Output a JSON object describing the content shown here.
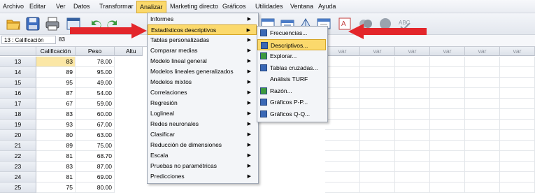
{
  "menubar": {
    "items": [
      "Archivo",
      "Editar",
      "Ver",
      "Datos",
      "Transformar",
      "Analizar",
      "Marketing directo",
      "Gráficos",
      "Utilidades",
      "Ventana",
      "Ayuda"
    ]
  },
  "refbar": {
    "cell_ref": "13 : Calificación",
    "cell_value": "83"
  },
  "grid": {
    "columns": [
      "Calificación",
      "Peso",
      "Altu",
      "var",
      "var",
      "var",
      "var",
      "var",
      "var",
      "var"
    ],
    "rows": [
      {
        "n": "13",
        "c": "83",
        "p": "78.00"
      },
      {
        "n": "14",
        "c": "89",
        "p": "95.00"
      },
      {
        "n": "15",
        "c": "95",
        "p": "49.00"
      },
      {
        "n": "16",
        "c": "87",
        "p": "54.00"
      },
      {
        "n": "17",
        "c": "67",
        "p": "59.00"
      },
      {
        "n": "18",
        "c": "83",
        "p": "60.00"
      },
      {
        "n": "19",
        "c": "93",
        "p": "67.00"
      },
      {
        "n": "20",
        "c": "80",
        "p": "63.00"
      },
      {
        "n": "21",
        "c": "89",
        "p": "75.00"
      },
      {
        "n": "22",
        "c": "81",
        "p": "68.70"
      },
      {
        "n": "23",
        "c": "83",
        "p": "87.00"
      },
      {
        "n": "24",
        "c": "81",
        "p": "69.00"
      },
      {
        "n": "25",
        "c": "75",
        "p": "80.00"
      }
    ]
  },
  "analizar_menu": {
    "items": [
      {
        "label": "Informes",
        "sub": true
      },
      {
        "label": "Estadísticos descriptivos",
        "sub": true
      },
      {
        "label": "Tablas personalizadas",
        "sub": true
      },
      {
        "label": "Comparar medias",
        "sub": true
      },
      {
        "label": "Modelo lineal general",
        "sub": true
      },
      {
        "label": "Modelos lineales generalizados",
        "sub": true
      },
      {
        "label": "Modelos mixtos",
        "sub": true
      },
      {
        "label": "Correlaciones",
        "sub": true
      },
      {
        "label": "Regresión",
        "sub": true
      },
      {
        "label": "Loglineal",
        "sub": true
      },
      {
        "label": "Redes neuronales",
        "sub": true
      },
      {
        "label": "Clasificar",
        "sub": true
      },
      {
        "label": "Reducción de dimensiones",
        "sub": true
      },
      {
        "label": "Escala",
        "sub": true
      },
      {
        "label": "Pruebas no paramétricas",
        "sub": true
      },
      {
        "label": "Predicciones",
        "sub": true
      }
    ],
    "highlighted": "Estadísticos descriptivos"
  },
  "descriptivos_submenu": {
    "items": [
      {
        "label": "Frecuencias...",
        "icon": "frequencies-icon"
      },
      {
        "label": "Descriptivos...",
        "icon": "descriptives-icon"
      },
      {
        "label": "Explorar...",
        "icon": "explore-icon"
      },
      {
        "label": "Tablas cruzadas...",
        "icon": "crosstabs-icon"
      },
      {
        "label": "Análisis TURF",
        "icon": ""
      },
      {
        "label": "Razón...",
        "icon": "ratio-icon"
      },
      {
        "label": "Gráficos P-P...",
        "icon": "pp-plot-icon"
      },
      {
        "label": "Gráficos Q-Q...",
        "icon": "qq-plot-icon"
      }
    ],
    "highlighted": "Descriptivos..."
  },
  "colors": {
    "highlight": "#fbd96c",
    "arrow": "#e3262b",
    "menu_bg": "#f3f5f8"
  }
}
